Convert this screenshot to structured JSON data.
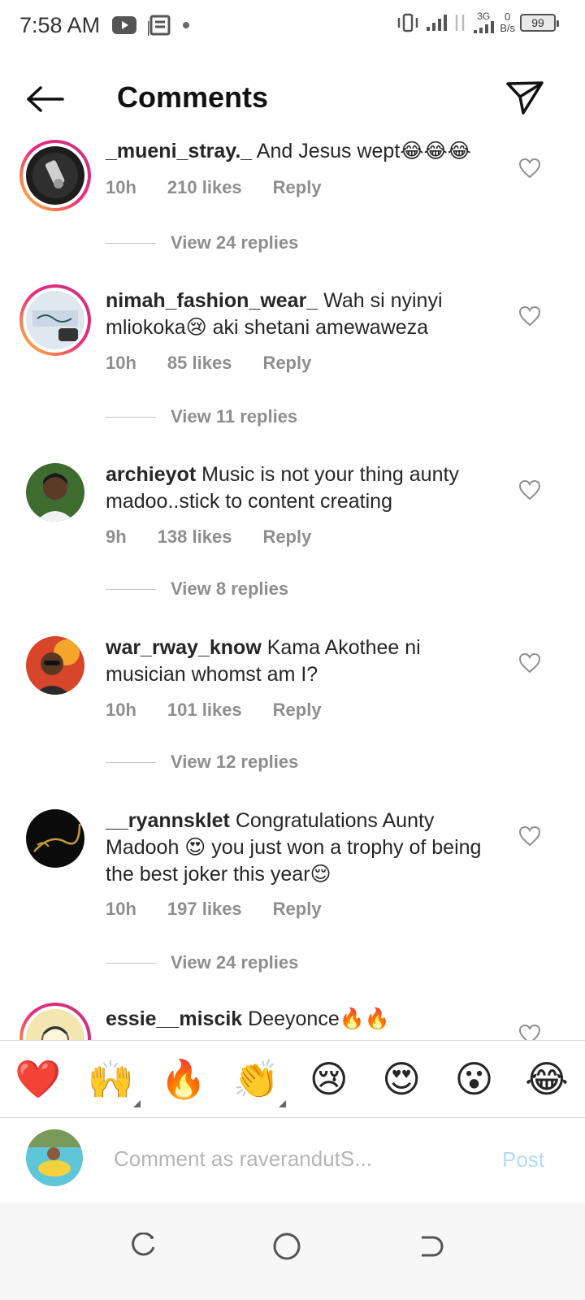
{
  "status_bar": {
    "time": "7:58 AM",
    "net_speed_value": "0",
    "net_speed_unit": "B/s",
    "network_type": "3G",
    "battery": "99"
  },
  "header": {
    "title": "Comments"
  },
  "comments": [
    {
      "username": "_mueni_stray._",
      "text": " And Jesus wept😂😂😂",
      "time": "10h",
      "likes": "210 likes",
      "reply": "Reply",
      "view_replies": "View 24 replies",
      "avatar_icon": "avatar-mueni"
    },
    {
      "username": "nimah_fashion_wear_",
      "text": " Wah si nyinyi mliokoka😢 aki shetani amewaweza",
      "time": "10h",
      "likes": "85 likes",
      "reply": "Reply",
      "view_replies": "View 11 replies",
      "avatar_icon": "avatar-nimah"
    },
    {
      "username": "archieyot",
      "text": " Music is not your thing aunty madoo..stick to content creating",
      "time": "9h",
      "likes": "138 likes",
      "reply": "Reply",
      "view_replies": "View 8 replies",
      "avatar_icon": "avatar-archieyot"
    },
    {
      "username": "war_rway_know",
      "text": " Kama Akothee ni musician whomst am I?",
      "time": "10h",
      "likes": "101 likes",
      "reply": "Reply",
      "view_replies": "View 12 replies",
      "avatar_icon": "avatar-war"
    },
    {
      "username": "__ryannsklet",
      "text": " Congratulations Aunty Madooh 😍 you just won a trophy of being the best joker this year😌",
      "time": "10h",
      "likes": "197 likes",
      "reply": "Reply",
      "view_replies": "View 24 replies",
      "avatar_icon": "avatar-ryannsklet"
    },
    {
      "username": "essie__miscik",
      "text": " Deeyonce🔥🔥",
      "avatar_icon": "avatar-essie"
    }
  ],
  "emoji_bar": [
    "❤️",
    "🙌",
    "🔥",
    "👏",
    "😢",
    "😍",
    "😮",
    "😂"
  ],
  "comment_input": {
    "placeholder": "Comment as raverandutS...",
    "post_label": "Post"
  },
  "colors": {
    "text": "#262626",
    "meta": "#8e8e8e",
    "post_disabled": "#b3dbff",
    "story_ring_start": "#f9ce34",
    "story_ring_end": "#c13584"
  }
}
